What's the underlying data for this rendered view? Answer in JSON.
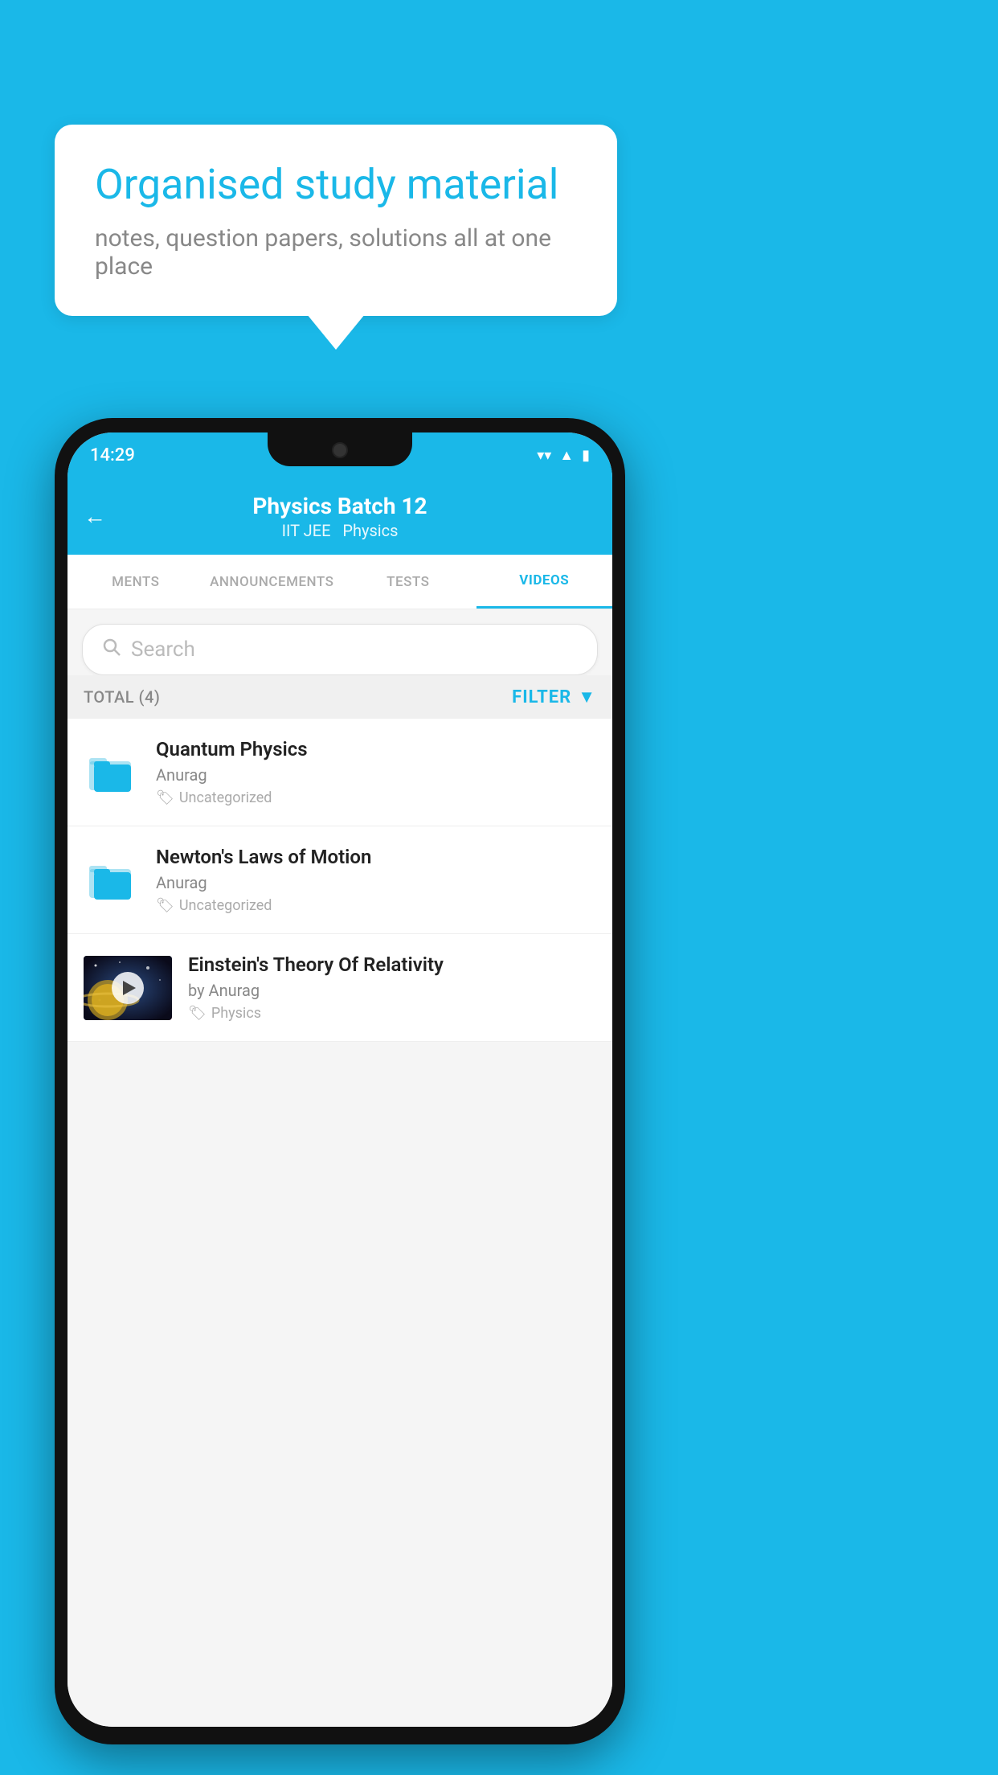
{
  "background": {
    "color": "#1ab8e8"
  },
  "speech_bubble": {
    "title": "Organised study material",
    "subtitle": "notes, question papers, solutions all at one place"
  },
  "status_bar": {
    "time": "14:29",
    "wifi": "▾",
    "signal": "▲",
    "battery": "▮"
  },
  "header": {
    "title": "Physics Batch 12",
    "subtitle_part1": "IIT JEE",
    "subtitle_part2": "Physics",
    "back_label": "←"
  },
  "tabs": [
    {
      "label": "MENTS",
      "active": false
    },
    {
      "label": "ANNOUNCEMENTS",
      "active": false
    },
    {
      "label": "TESTS",
      "active": false
    },
    {
      "label": "VIDEOS",
      "active": true
    }
  ],
  "search": {
    "placeholder": "Search"
  },
  "filter_row": {
    "total_label": "TOTAL (4)",
    "filter_label": "FILTER"
  },
  "videos": [
    {
      "id": 1,
      "title": "Quantum Physics",
      "author": "Anurag",
      "tag": "Uncategorized",
      "type": "folder",
      "has_thumb": false
    },
    {
      "id": 2,
      "title": "Newton's Laws of Motion",
      "author": "Anurag",
      "tag": "Uncategorized",
      "type": "folder",
      "has_thumb": false
    },
    {
      "id": 3,
      "title": "Einstein's Theory Of Relativity",
      "author": "by Anurag",
      "tag": "Physics",
      "type": "video",
      "has_thumb": true
    }
  ]
}
